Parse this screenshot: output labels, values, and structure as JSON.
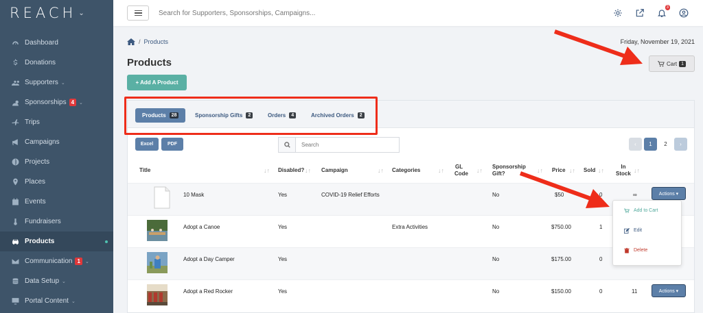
{
  "app": {
    "logo": "REACH",
    "logo_caret": "⌄"
  },
  "sidebar": {
    "items": [
      {
        "label": "Dashboard",
        "icon": "dashboard-icon",
        "caret": "",
        "badge": "",
        "active": false
      },
      {
        "label": "Donations",
        "icon": "dollar-icon",
        "caret": "",
        "badge": "",
        "active": false
      },
      {
        "label": "Supporters",
        "icon": "users-icon",
        "caret": "⌄",
        "badge": "",
        "active": false
      },
      {
        "label": "Sponsorships",
        "icon": "user-icon",
        "caret": "⌄",
        "badge": "4",
        "active": false
      },
      {
        "label": "Trips",
        "icon": "plane-icon",
        "caret": "",
        "badge": "",
        "active": false
      },
      {
        "label": "Campaigns",
        "icon": "megaphone-icon",
        "caret": "",
        "badge": "",
        "active": false
      },
      {
        "label": "Projects",
        "icon": "globe-icon",
        "caret": "",
        "badge": "",
        "active": false
      },
      {
        "label": "Places",
        "icon": "map-pin-icon",
        "caret": "",
        "badge": "",
        "active": false
      },
      {
        "label": "Events",
        "icon": "calendar-icon",
        "caret": "",
        "badge": "",
        "active": false
      },
      {
        "label": "Fundraisers",
        "icon": "thermometer-icon",
        "caret": "",
        "badge": "",
        "active": false
      },
      {
        "label": "Products",
        "icon": "car-icon",
        "caret": "",
        "badge": "",
        "active": true
      },
      {
        "label": "Communication",
        "icon": "envelope-icon",
        "caret": "⌄",
        "badge": "1",
        "active": false
      },
      {
        "label": "Data Setup",
        "icon": "database-icon",
        "caret": "⌄",
        "badge": "",
        "active": false
      },
      {
        "label": "Portal Content",
        "icon": "monitor-icon",
        "caret": "⌄",
        "badge": "",
        "active": false
      }
    ]
  },
  "topbar": {
    "search_placeholder": "Search for Supporters, Sponsorships, Campaigns...",
    "notification_count": "3"
  },
  "breadcrumb": {
    "sep": "/",
    "current": "Products"
  },
  "date": "Friday, November 19, 2021",
  "page_title": "Products",
  "cart": {
    "label": "Cart",
    "count": "1"
  },
  "add_button": "+ Add A Product",
  "tabs": [
    {
      "label": "Products",
      "count": "28",
      "active": true
    },
    {
      "label": "Sponsorship Gifts",
      "count": "2",
      "active": false
    },
    {
      "label": "Orders",
      "count": "4",
      "active": false
    },
    {
      "label": "Archived Orders",
      "count": "2",
      "active": false
    }
  ],
  "export": {
    "excel": "Excel",
    "pdf": "PDF"
  },
  "table_search_placeholder": "Search",
  "pagination": {
    "prev": "‹",
    "pages": [
      "1",
      "2"
    ],
    "current": "1",
    "next": "›"
  },
  "columns": {
    "title": "Title",
    "disabled": "Disabled?",
    "campaign": "Campaign",
    "categories": "Categories",
    "gl_code_1": "GL",
    "gl_code_2": "Code",
    "sponsorship_1": "Sponsorship",
    "sponsorship_2": "Gift?",
    "price": "Price",
    "sold": "Sold",
    "in_stock_1": "In",
    "in_stock_2": "Stock"
  },
  "rows": [
    {
      "title": "10 Mask",
      "disabled": "Yes",
      "campaign": "COVID-19 Relief Efforts",
      "categories": "",
      "gl": "",
      "sponsorship": "No",
      "price": "$50",
      "sold": "0",
      "stock": "∞",
      "actions": "Actions ▾"
    },
    {
      "title": "Adopt a Canoe",
      "disabled": "Yes",
      "campaign": "",
      "categories": "Extra Activities",
      "gl": "",
      "sponsorship": "No",
      "price": "$750.00",
      "sold": "1",
      "stock": "",
      "actions": ""
    },
    {
      "title": "Adopt a Day Camper",
      "disabled": "Yes",
      "campaign": "",
      "categories": "",
      "gl": "",
      "sponsorship": "No",
      "price": "$175.00",
      "sold": "0",
      "stock": "",
      "actions": ""
    },
    {
      "title": "Adopt a Red Rocker",
      "disabled": "Yes",
      "campaign": "",
      "categories": "",
      "gl": "",
      "sponsorship": "No",
      "price": "$150.00",
      "sold": "0",
      "stock": "11",
      "actions": "Actions ▾"
    }
  ],
  "dropdown": {
    "add_to_cart": "Add to Cart",
    "edit": "Edit",
    "delete": "Delete"
  },
  "colors": {
    "sidebar": "#3e5469",
    "accent": "#5c7fa8",
    "teal": "#5ab0a4",
    "annotation": "#ee2d1a",
    "badge": "#e0383a"
  }
}
